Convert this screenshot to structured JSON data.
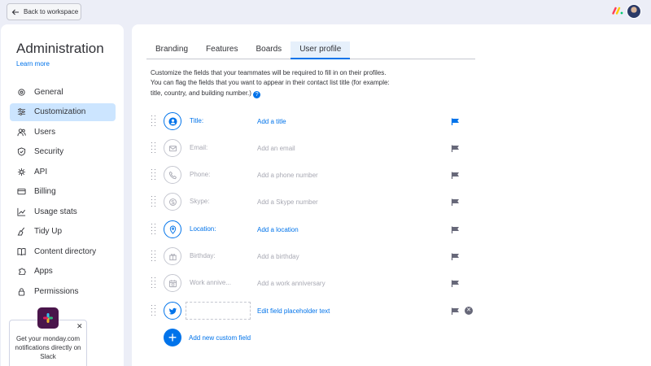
{
  "topbar": {
    "back_label": "Back to workspace"
  },
  "sidebar": {
    "title": "Administration",
    "learn_more": "Learn more",
    "items": [
      {
        "label": "General",
        "icon": "gear-icon",
        "active": false
      },
      {
        "label": "Customization",
        "icon": "sliders-icon",
        "active": true
      },
      {
        "label": "Users",
        "icon": "users-icon",
        "active": false
      },
      {
        "label": "Security",
        "icon": "shield-icon",
        "active": false
      },
      {
        "label": "API",
        "icon": "api-icon",
        "active": false
      },
      {
        "label": "Billing",
        "icon": "card-icon",
        "active": false
      },
      {
        "label": "Usage stats",
        "icon": "chart-icon",
        "active": false
      },
      {
        "label": "Tidy Up",
        "icon": "broom-icon",
        "active": false
      },
      {
        "label": "Content directory",
        "icon": "book-icon",
        "active": false
      },
      {
        "label": "Apps",
        "icon": "apps-icon",
        "active": false
      },
      {
        "label": "Permissions",
        "icon": "lock-icon",
        "active": false
      }
    ],
    "promo": {
      "text": "Get your monday.com notifications directly on Slack"
    }
  },
  "main": {
    "tabs": [
      {
        "label": "Branding",
        "active": false
      },
      {
        "label": "Features",
        "active": false
      },
      {
        "label": "Boards",
        "active": false
      },
      {
        "label": "User profile",
        "active": true
      }
    ],
    "description_line1": "Customize the fields that your teammates will be required to fill in on their profiles.",
    "description_line2": "You can flag the fields that you want to appear in their contact list title (for example:",
    "description_line3": "title, country, and building number.)",
    "fields": [
      {
        "label": "Title:",
        "placeholder": "Add a title",
        "active": true,
        "icon": "person-icon",
        "flagged": true
      },
      {
        "label": "Email:",
        "placeholder": "Add an email",
        "active": false,
        "icon": "email-icon",
        "flagged": false
      },
      {
        "label": "Phone:",
        "placeholder": "Add a phone number",
        "active": false,
        "icon": "phone-icon",
        "flagged": false
      },
      {
        "label": "Skype:",
        "placeholder": "Add a Skype number",
        "active": false,
        "icon": "skype-icon",
        "flagged": false
      },
      {
        "label": "Location:",
        "placeholder": "Add a location",
        "active": true,
        "icon": "location-icon",
        "flagged": false
      },
      {
        "label": "Birthday:",
        "placeholder": "Add a birthday",
        "active": false,
        "icon": "gift-icon",
        "flagged": false
      },
      {
        "label": "Work annive...",
        "placeholder": "Add a work anniversary",
        "active": false,
        "icon": "calendar-icon",
        "flagged": false
      }
    ],
    "custom_field": {
      "placeholder": "Edit field placeholder text",
      "icon": "twitter-icon"
    },
    "add_custom_label": "Add new custom field",
    "colors": {
      "accent": "#0073ea",
      "muted": "#a8a9b3",
      "active_nav": "#cce5ff"
    }
  }
}
